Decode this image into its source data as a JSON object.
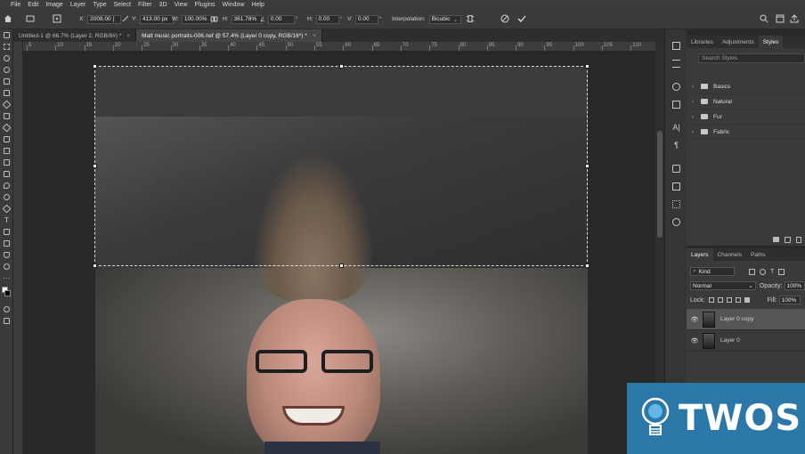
{
  "menu": [
    "File",
    "Edit",
    "Image",
    "Layer",
    "Type",
    "Select",
    "Filter",
    "3D",
    "View",
    "Plugins",
    "Window",
    "Help"
  ],
  "options": {
    "x_label": "X:",
    "x_value": "2008.00 |",
    "y_label": "Y:",
    "y_value": "413.00 px",
    "w_label": "W:",
    "w_value": "100.00%",
    "h_label": "H:",
    "h_value": "361.78%",
    "angle_value": "0.00",
    "hskew_label": "H:",
    "hskew_value": "0.00",
    "vskew_label": "V:",
    "vskew_value": "0.00",
    "interp_label": "Interpolation:",
    "interp_value": "Bicubic"
  },
  "tabs": [
    {
      "label": "Untitled-1 @ 66.7% (Layer 2, RGB/8#) *",
      "close": "×"
    },
    {
      "label": "Matt music portraits-006.nef @ 57.4% (Layer 0 copy, RGB/16*) *",
      "close": "×"
    }
  ],
  "ruler_labels": [
    "5",
    "10",
    "15",
    "20",
    "25",
    "30",
    "35",
    "40",
    "45",
    "50",
    "55",
    "60",
    "65",
    "70",
    "75",
    "80",
    "85",
    "90",
    "95",
    "100",
    "105",
    "110"
  ],
  "libraries_panel": {
    "tabs": [
      "Libraries",
      "Adjustments",
      "Styles"
    ],
    "active_tab": "Styles",
    "search_placeholder": "Search Styles",
    "groups": [
      "Basics",
      "Natural",
      "Fur",
      "Fabric"
    ]
  },
  "layers_panel": {
    "tabs": [
      "Layers",
      "Channels",
      "Paths"
    ],
    "active_tab": "Layers",
    "kind_label": "Kind",
    "blend_mode": "Normal",
    "opacity_label": "Opacity:",
    "opacity_value": "100%",
    "lock_label": "Lock:",
    "fill_label": "Fill:",
    "fill_value": "100%",
    "layers": [
      "Layer 0 copy",
      "Layer 0"
    ]
  },
  "watermark": {
    "text": "TWOS"
  }
}
